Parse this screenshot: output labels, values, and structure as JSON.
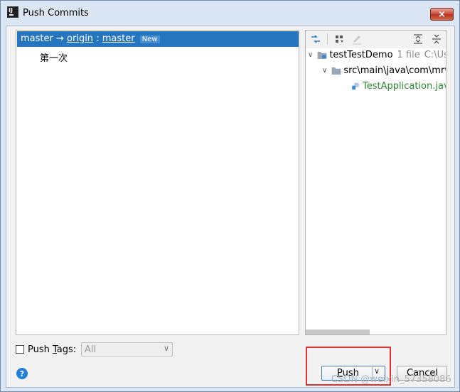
{
  "window": {
    "title": "Push Commits",
    "close_label": "×"
  },
  "branch": {
    "local": "master",
    "arrow": "→",
    "remote": "origin",
    "separator": ":",
    "remote_branch": "master",
    "badge": "New"
  },
  "commits": [
    {
      "message": "第一次"
    }
  ],
  "toolbar_icons": [
    "show-diff-icon",
    "group-by-icon",
    "edit-icon",
    "expand-all-icon",
    "collapse-all-icon"
  ],
  "tree": {
    "root": {
      "name": "testTestDemo",
      "count": "1 file",
      "path": "C:\\Use"
    },
    "folder": {
      "name": "src\\main\\java\\com\\mrw"
    },
    "file": {
      "name": "TestApplication.java"
    }
  },
  "push_tags": {
    "label_prefix": "Push ",
    "label_underline": "T",
    "label_suffix": "ags:",
    "selected": "All"
  },
  "buttons": {
    "push_prefix": "",
    "push_underline": "P",
    "push_suffix": "ush",
    "cancel": "Cancel"
  },
  "help_label": "?",
  "watermark": "CSDN @weixin_57358086",
  "colors": {
    "selection": "#2675bf",
    "modified_file": "#2b8a2b",
    "highlight_box": "#e03131",
    "help": "#1f7fd9"
  }
}
